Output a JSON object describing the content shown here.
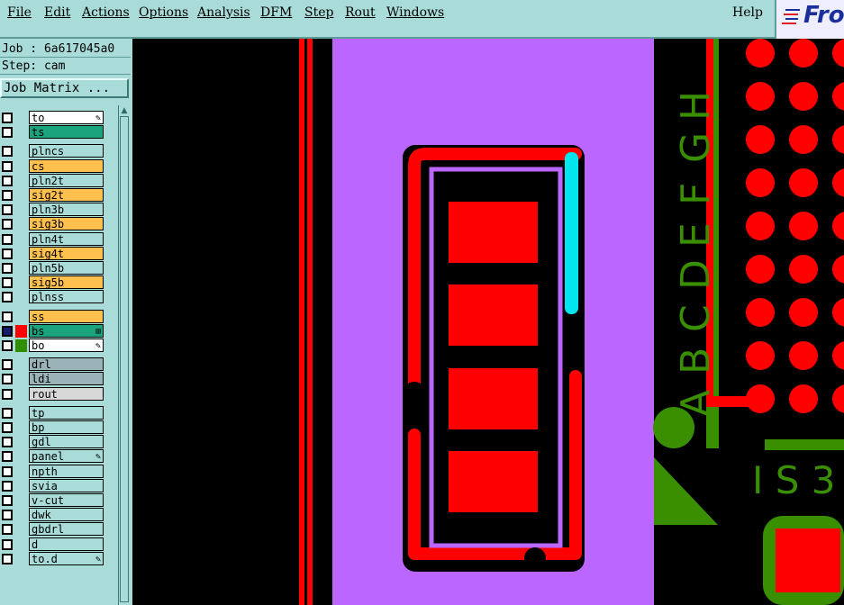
{
  "menubar": {
    "items": [
      "File",
      "Edit",
      "Actions",
      "Options",
      "Analysis",
      "DFM",
      "Step",
      "Rout",
      "Windows"
    ],
    "help": "Help",
    "logo_text": "Fro"
  },
  "job": {
    "job_label": "Job : 6a617045a0",
    "step_label": "Step: cam",
    "matrix_button": "Job Matrix ..."
  },
  "layers": [
    {
      "name": "to",
      "color": "#ffffff",
      "mark": "✎",
      "swatch": ""
    },
    {
      "name": "ts",
      "color": "#1aa37c",
      "mark": "",
      "swatch": ""
    },
    {
      "name": "plncs",
      "color": "#a9dcd9",
      "mark": "",
      "swatch": ""
    },
    {
      "name": "cs",
      "color": "#ffc04d",
      "mark": "",
      "swatch": ""
    },
    {
      "name": "pln2t",
      "color": "#a9dcd9",
      "mark": "",
      "swatch": ""
    },
    {
      "name": "sig2t",
      "color": "#ffc04d",
      "mark": "",
      "swatch": ""
    },
    {
      "name": "pln3b",
      "color": "#a9dcd9",
      "mark": "",
      "swatch": ""
    },
    {
      "name": "sig3b",
      "color": "#ffc04d",
      "mark": "",
      "swatch": ""
    },
    {
      "name": "pln4t",
      "color": "#a9dcd9",
      "mark": "",
      "swatch": ""
    },
    {
      "name": "sig4t",
      "color": "#ffc04d",
      "mark": "",
      "swatch": ""
    },
    {
      "name": "pln5b",
      "color": "#a9dcd9",
      "mark": "",
      "swatch": ""
    },
    {
      "name": "sig5b",
      "color": "#ffc04d",
      "mark": "",
      "swatch": ""
    },
    {
      "name": "plnss",
      "color": "#a9dcd9",
      "mark": "",
      "swatch": ""
    },
    {
      "name": "ss",
      "color": "#ffc04d",
      "mark": "",
      "swatch": ""
    },
    {
      "name": "bs",
      "color": "#1aa37c",
      "mark": "⊞",
      "swatch": "#ff0000",
      "checked": true
    },
    {
      "name": "bo",
      "color": "#ffffff",
      "mark": "✎",
      "swatch": "#2f8f00"
    },
    {
      "name": "drl",
      "color": "#9ab3b8",
      "mark": "",
      "swatch": ""
    },
    {
      "name": "ldi",
      "color": "#9ab3b8",
      "mark": "",
      "swatch": ""
    },
    {
      "name": "rout",
      "color": "#d8d8d8",
      "mark": "",
      "swatch": ""
    },
    {
      "name": "tp",
      "color": "#a9dcd9",
      "mark": "",
      "swatch": ""
    },
    {
      "name": "bp",
      "color": "#a9dcd9",
      "mark": "",
      "swatch": ""
    },
    {
      "name": "gdl",
      "color": "#a9dcd9",
      "mark": "",
      "swatch": ""
    },
    {
      "name": "panel",
      "color": "#a9dcd9",
      "mark": "✎",
      "swatch": ""
    },
    {
      "name": "npth",
      "color": "#a9dcd9",
      "mark": "",
      "swatch": ""
    },
    {
      "name": "svia",
      "color": "#a9dcd9",
      "mark": "",
      "swatch": ""
    },
    {
      "name": "v-cut",
      "color": "#a9dcd9",
      "mark": "",
      "swatch": ""
    },
    {
      "name": "dwk",
      "color": "#a9dcd9",
      "mark": "",
      "swatch": ""
    },
    {
      "name": "gbdrl",
      "color": "#a9dcd9",
      "mark": "",
      "swatch": ""
    },
    {
      "name": "d",
      "color": "#a9dcd9",
      "mark": "",
      "swatch": ""
    },
    {
      "name": "to.d",
      "color": "#a9dcd9",
      "mark": "✎",
      "swatch": ""
    }
  ],
  "pcb": {
    "silk_text_left": [
      "A",
      "B",
      "C",
      "D",
      "E",
      "F",
      "G",
      "H"
    ],
    "silk_text_bottom": "I S 3",
    "colors": {
      "board": "#bb66ff",
      "copper": "#ff0000",
      "highlight": "#00e5ee",
      "silk": "#3a8f00"
    }
  }
}
